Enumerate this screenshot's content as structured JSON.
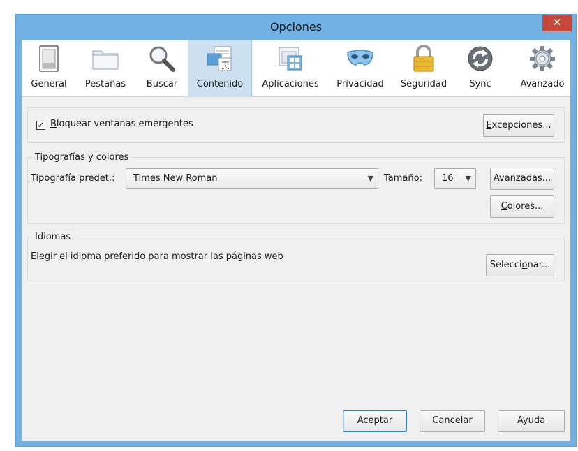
{
  "window": {
    "title": "Opciones",
    "close_glyph": "✕"
  },
  "toolbar": {
    "items": [
      {
        "label": "General",
        "icon": "switch-icon"
      },
      {
        "label": "Pestañas",
        "icon": "folder-tabs-icon"
      },
      {
        "label": "Buscar",
        "icon": "magnifier-icon"
      },
      {
        "label": "Contenido",
        "icon": "content-icon",
        "active": true
      },
      {
        "label": "Aplicaciones",
        "icon": "applications-icon"
      },
      {
        "label": "Privacidad",
        "icon": "mask-icon"
      },
      {
        "label": "Seguridad",
        "icon": "padlock-icon"
      },
      {
        "label": "Sync",
        "icon": "sync-icon"
      },
      {
        "label": "Avanzado",
        "icon": "gear-icon"
      }
    ]
  },
  "popups": {
    "checkbox_checked": true,
    "label_first": "B",
    "label_rest": "loquear ventanas emergentes",
    "exceptions_first": "E",
    "exceptions_rest": "xcepciones..."
  },
  "fonts": {
    "legend": "Tipografías y colores",
    "default_font_first": "T",
    "default_font_rest": "ipografía predet.:",
    "default_font_value": "Times New Roman",
    "size_pre": "Ta",
    "size_u": "m",
    "size_post": "año:",
    "size_value": "16",
    "advanced_first": "A",
    "advanced_rest": "vanzadas...",
    "colors_first": "C",
    "colors_rest": "olores..."
  },
  "languages": {
    "legend": "Idiomas",
    "text_pre": "Elegir el idi",
    "text_u": "o",
    "text_post": "ma preferido para mostrar las páginas web",
    "choose_pre": "Selecci",
    "choose_u": "o",
    "choose_post": "nar..."
  },
  "footer": {
    "ok": "Aceptar",
    "cancel": "Cancelar",
    "help_pre": "Ay",
    "help_u": "u",
    "help_post": "da"
  }
}
